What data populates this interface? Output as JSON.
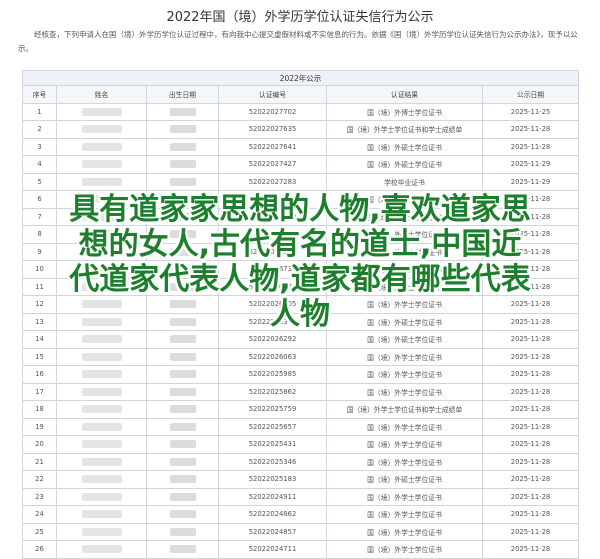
{
  "page_title": "2022年国（境）外学历学位认证失信行为公示",
  "notice": "经核查，下列申请人在国（境）外学历学位认证过程中，有向我中心提交虚假材料或不实信息的行为。依据《国（境）外学历学位认证失信行为公示办法》，现予以公示。",
  "table": {
    "caption": "2022年公示",
    "headers": [
      "序号",
      "姓名",
      "出生日期",
      "认证编号",
      "认证结果",
      "公示日期"
    ],
    "rows": [
      [
        "1",
        "",
        "",
        "52022027702",
        "国（境）外博士学位证书",
        "2025-11-25"
      ],
      [
        "2",
        "",
        "",
        "52022027635",
        "国（境）外学士学位证书和学士成绩单",
        "2025-11-28"
      ],
      [
        "3",
        "",
        "",
        "52022027641",
        "国（境）外硕士学位证书",
        "2025-11-28"
      ],
      [
        "4",
        "",
        "",
        "52022027427",
        "国（境）外硕士学位证书",
        "2025-11-29"
      ],
      [
        "5",
        "",
        "",
        "52022027283",
        "学校毕业证书",
        "2025-11-29"
      ],
      [
        "6",
        "",
        "",
        "52022027184",
        "国（境）外硕士学位证书",
        "2025-11-28"
      ],
      [
        "7",
        "",
        "",
        "52022026912",
        "国（境）外硕士学位证书",
        "2025-11-28"
      ],
      [
        "8",
        "",
        "",
        "52022026877",
        "国（境）外学士学位证书",
        "2025-11-28"
      ],
      [
        "9",
        "",
        "",
        "52022026851",
        "国（境）外硕士学位证书",
        "2025-11-28"
      ],
      [
        "10",
        "",
        "",
        "52022026734",
        "国（境）外硕士学位证书",
        "2025-11-28"
      ],
      [
        "11",
        "",
        "",
        "52022026583",
        "国（境）外硕士学位证书",
        "2025-11-28"
      ],
      [
        "12",
        "",
        "",
        "52022026505",
        "国（境）外学士学位证书",
        "2025-11-28"
      ],
      [
        "13",
        "",
        "",
        "52022026345",
        "国（境）外硕士学位证书",
        "2025-11-28"
      ],
      [
        "14",
        "",
        "",
        "52022026292",
        "国（境）外硕士学位证书",
        "2025-11-28"
      ],
      [
        "15",
        "",
        "",
        "52022026063",
        "国（境）外学士学位证书",
        "2025-11-28"
      ],
      [
        "16",
        "",
        "",
        "52022025985",
        "国（境）外学士学位证书",
        "2025-11-28"
      ],
      [
        "17",
        "",
        "",
        "52022025862",
        "国（境）外学士学位证书",
        "2025-11-28"
      ],
      [
        "18",
        "",
        "",
        "52022025759",
        "国（境）外学士学位证书和学士成绩单",
        "2025-11-28"
      ],
      [
        "19",
        "",
        "",
        "52022025657",
        "国（境）外学士学位证书",
        "2025-11-28"
      ],
      [
        "20",
        "",
        "",
        "52022025431",
        "国（境）外学士学位证书",
        "2025-11-28"
      ],
      [
        "21",
        "",
        "",
        "52022025346",
        "国（境）外学士学位证书",
        "2025-11-28"
      ],
      [
        "22",
        "",
        "",
        "52022025183",
        "国（境）外硕士学位证书",
        "2025-11-28"
      ],
      [
        "23",
        "",
        "",
        "52022024911",
        "国（境）外学士学位证书",
        "2025-11-28"
      ],
      [
        "24",
        "",
        "",
        "52022024862",
        "国（境）外学士学位证书",
        "2025-11-28"
      ],
      [
        "25",
        "",
        "",
        "52022024857",
        "国（境）外学士学位证书",
        "2025-11-28"
      ],
      [
        "26",
        "",
        "",
        "52022024711",
        "国（境）外学士学位证书",
        "2025-11-28"
      ]
    ]
  },
  "overlay_lines": [
    "具有道家家思想的人物,喜欢道家思",
    "想的女人,古代有名的道士,中国近",
    "代道家代表人物,道家都有哪些代表",
    "人物"
  ]
}
